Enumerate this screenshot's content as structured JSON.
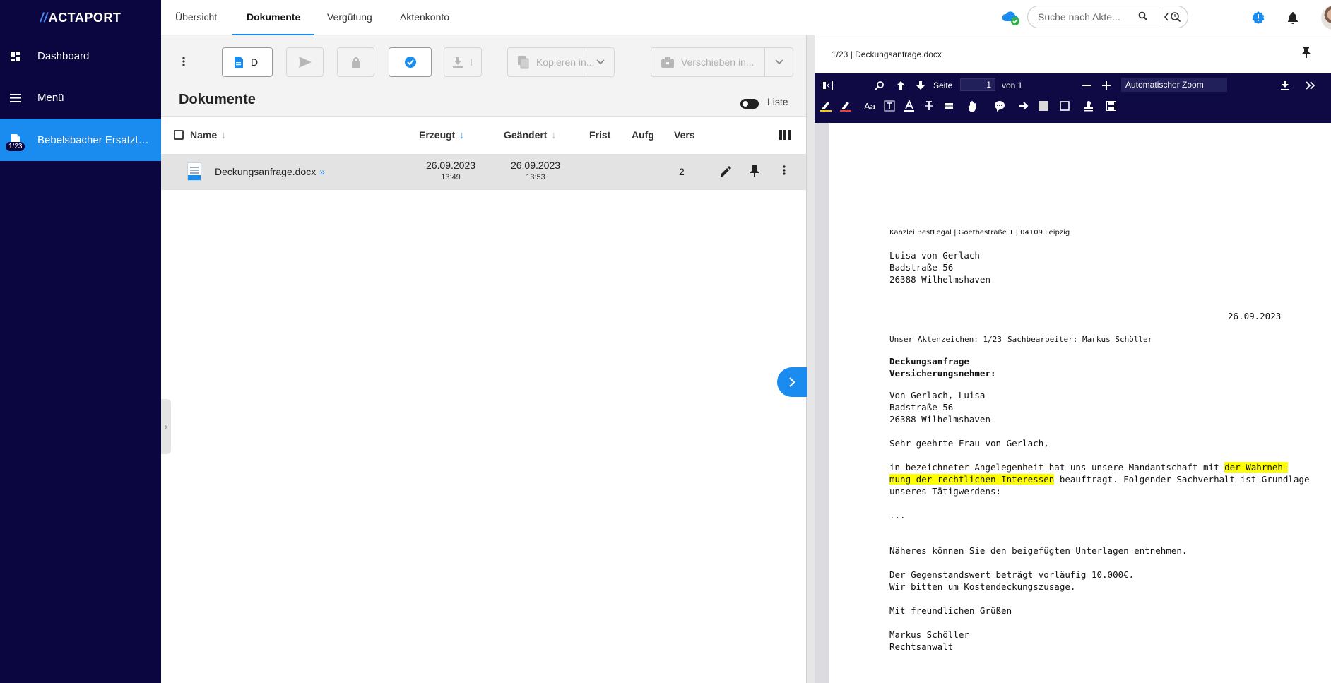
{
  "app": {
    "logo": "ACTAPORT"
  },
  "sidebar": {
    "items": [
      {
        "label": "Dashboard",
        "icon": "dashboard-icon"
      },
      {
        "label": "Menü",
        "icon": "menu-icon"
      },
      {
        "label": "Bebelsbacher Ersatzte...",
        "icon": "file-icon",
        "badge": "1/23"
      }
    ]
  },
  "topnav": {
    "tabs": [
      "Übersicht",
      "Dokumente",
      "Vergütung",
      "Aktenkonto"
    ],
    "active_tab": "Dokumente",
    "search_placeholder": "Suche nach Akte..."
  },
  "toolbar": {
    "new_doc_label": "D",
    "download_label": "I",
    "copy_label": "Kopieren in...",
    "move_label": "Verschieben in..."
  },
  "documents": {
    "title": "Dokumente",
    "list_toggle_label": "Liste",
    "columns": [
      "Name",
      "Erzeugt",
      "Geändert",
      "Frist",
      "Aufg",
      "Vers"
    ],
    "rows": [
      {
        "name": "Deckungsanfrage.docx",
        "more": "»",
        "created_date": "26.09.2023",
        "created_time": "13:49",
        "changed_date": "26.09.2023",
        "changed_time": "13:53",
        "version": "2"
      }
    ]
  },
  "preview": {
    "title": "1/23 | Deckungsanfrage.docx",
    "page_label": "Seite",
    "page_number": "1",
    "page_of": "von 1",
    "zoom": "Automatischer Zoom",
    "letter": {
      "sender_line": "Kanzlei BestLegal | Goethestraße 1 | 04109 Leipzig",
      "recipient": [
        "Luisa von Gerlach",
        "Badstraße 56",
        "26388 Wilhelmshaven"
      ],
      "date": "26.09.2023",
      "reference": "Unser Aktenzeichen: 1/23",
      "clerk": "Sachbearbeiter: Markus Schöller",
      "subject": [
        "Deckungsanfrage",
        "Versicherungsnehmer:"
      ],
      "insured": [
        "Von Gerlach, Luisa",
        "Badstraße 56",
        "26388 Wilhelmshaven"
      ],
      "salutation": "Sehr geehrte Frau von Gerlach,",
      "body1_pre": "in bezeichneter Angelegenheit hat uns unsere Mandantschaft mit ",
      "body1_hl1": "der Wahrneh-",
      "body1_hl2": "mung der rechtlichen Interessen",
      "body1_post": " beauftragt. Folgender Sachverhalt ist Grundlage",
      "body1_line3": "unseres Tätigwerdens:",
      "ellipsis": "...",
      "body2": "Näheres können Sie den beigefügten Unterlagen entnehmen.",
      "body3": "Der Gegenstandswert beträgt vorläufig 10.000€.",
      "body4": "Wir bitten um Kostendeckungszusage.",
      "closing": "Mit freundlichen Grüßen",
      "signer": "Markus Schöller",
      "signer_title": "Rechtsanwalt"
    }
  },
  "colors": {
    "sidebar_bg": "#0b0640",
    "accent": "#1a8cf0",
    "pdf_toolbar_bg": "#100a44",
    "highlight": "#ffff00"
  }
}
